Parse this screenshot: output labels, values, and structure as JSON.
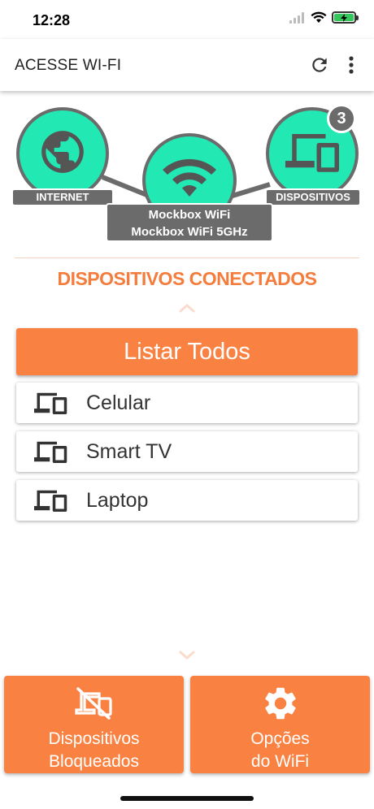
{
  "status_bar": {
    "time": "12:28"
  },
  "header": {
    "title": "ACESSE WI-FI"
  },
  "diagram": {
    "internet_label": "INTERNET",
    "devices_label": "DISPOSITIVOS",
    "devices_count": "3",
    "wifi_networks": [
      "Mockbox WiFi",
      "Mockbox WiFi 5GHz"
    ]
  },
  "section": {
    "title": "DISPOSITIVOS CONECTADOS"
  },
  "list_all_label": "Listar Todos",
  "devices": [
    {
      "name": "Celular"
    },
    {
      "name": "Smart TV"
    },
    {
      "name": "Laptop"
    }
  ],
  "bottom_buttons": {
    "blocked": {
      "line1": "Dispositivos",
      "line2": "Bloqueados"
    },
    "wifi_options": {
      "line1": "Opções",
      "line2": "do WiFi"
    }
  },
  "colors": {
    "accent": "#f98242",
    "node": "#22e8b4",
    "node_border": "#6b6b6b",
    "section_title": "#f47c3c"
  }
}
